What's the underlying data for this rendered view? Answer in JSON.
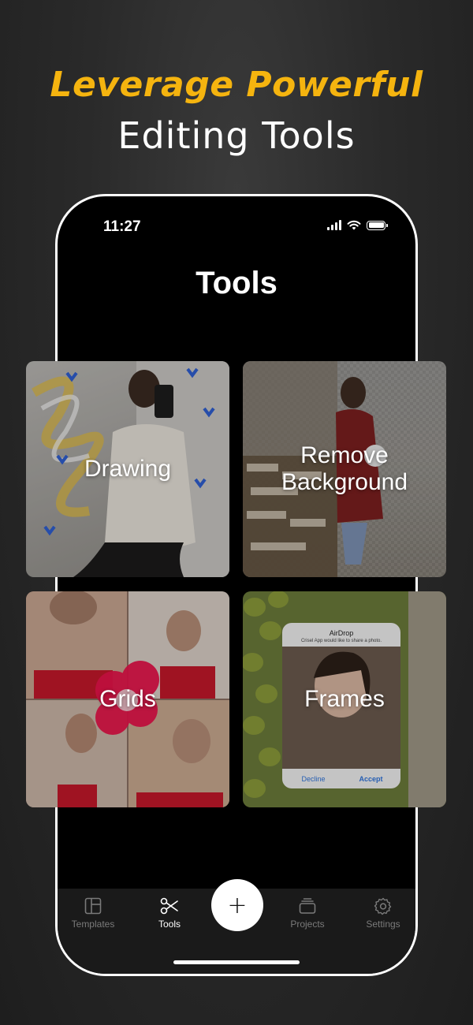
{
  "promo": {
    "headline_accent": "Leverage Powerful",
    "headline_main": "Editing Tools"
  },
  "status_bar": {
    "time": "11:27"
  },
  "screen": {
    "title": "Tools"
  },
  "tiles": [
    {
      "label": "Drawing"
    },
    {
      "label": "Remove Background"
    },
    {
      "label": "Grids"
    },
    {
      "label": "Frames"
    }
  ],
  "airdrop": {
    "title": "AirDrop",
    "message": "Crisel App would like to share a photo.",
    "decline": "Decline",
    "accept": "Accept"
  },
  "nav": {
    "templates": "Templates",
    "tools": "Tools",
    "add": "+",
    "projects": "Projects",
    "settings": "Settings",
    "active": "tools"
  },
  "colors": {
    "accent": "#f5b40f",
    "background": "#262626",
    "phone_screen": "#000000"
  }
}
